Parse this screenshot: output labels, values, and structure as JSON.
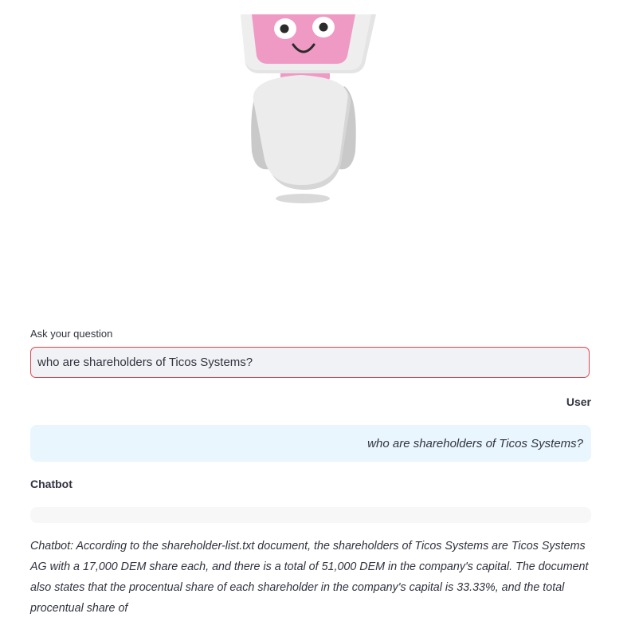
{
  "question": {
    "label": "Ask your question",
    "value": "who are shareholders of Ticos Systems?"
  },
  "conversation": {
    "user_label": "User",
    "user_message": "who are shareholders of Ticos Systems?",
    "bot_label": "Chatbot",
    "bot_message": "Chatbot: According to the shareholder-list.txt document, the shareholders of Ticos Systems are Ticos Systems AG with a 17,000 DEM share each, and there is a total of 51,000 DEM in the company's capital. The document also states that the procentual share of each shareholder in the company's capital is 33.33%, and the total procentual share of"
  },
  "colors": {
    "input_border": "#e0454d",
    "input_bg": "#f0f2f6",
    "user_bubble_bg": "#e9f6fd",
    "bot_bubble_bg": "#f7f7f8",
    "robot_face": "#ef9ac4",
    "robot_body": "#ececec"
  },
  "icons": {
    "mascot": "robot-mascot-illustration"
  }
}
